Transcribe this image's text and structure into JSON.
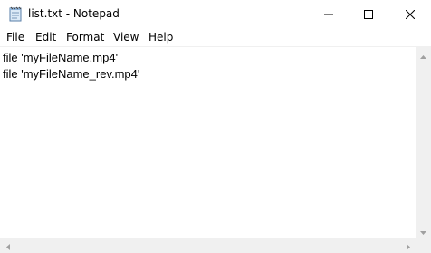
{
  "window": {
    "title": "list.txt - Notepad",
    "app_icon": "notepad-icon"
  },
  "caption_buttons": {
    "minimize_icon": "minimize-icon",
    "maximize_icon": "maximize-icon",
    "close_icon": "close-icon"
  },
  "menu": {
    "items": [
      {
        "label": "File"
      },
      {
        "label": "Edit"
      },
      {
        "label": "Format"
      },
      {
        "label": "View"
      },
      {
        "label": "Help"
      }
    ]
  },
  "editor": {
    "lines": [
      "file 'myFileName.mp4'",
      "file 'myFileName_rev.mp4'"
    ]
  },
  "scrollbars": {
    "up_icon": "arrow-up-icon",
    "down_icon": "arrow-down-icon",
    "left_icon": "arrow-left-icon",
    "right_icon": "arrow-right-icon"
  },
  "colors": {
    "background": "#ffffff",
    "scrollbar": "#f0f0f0",
    "text": "#000000"
  }
}
